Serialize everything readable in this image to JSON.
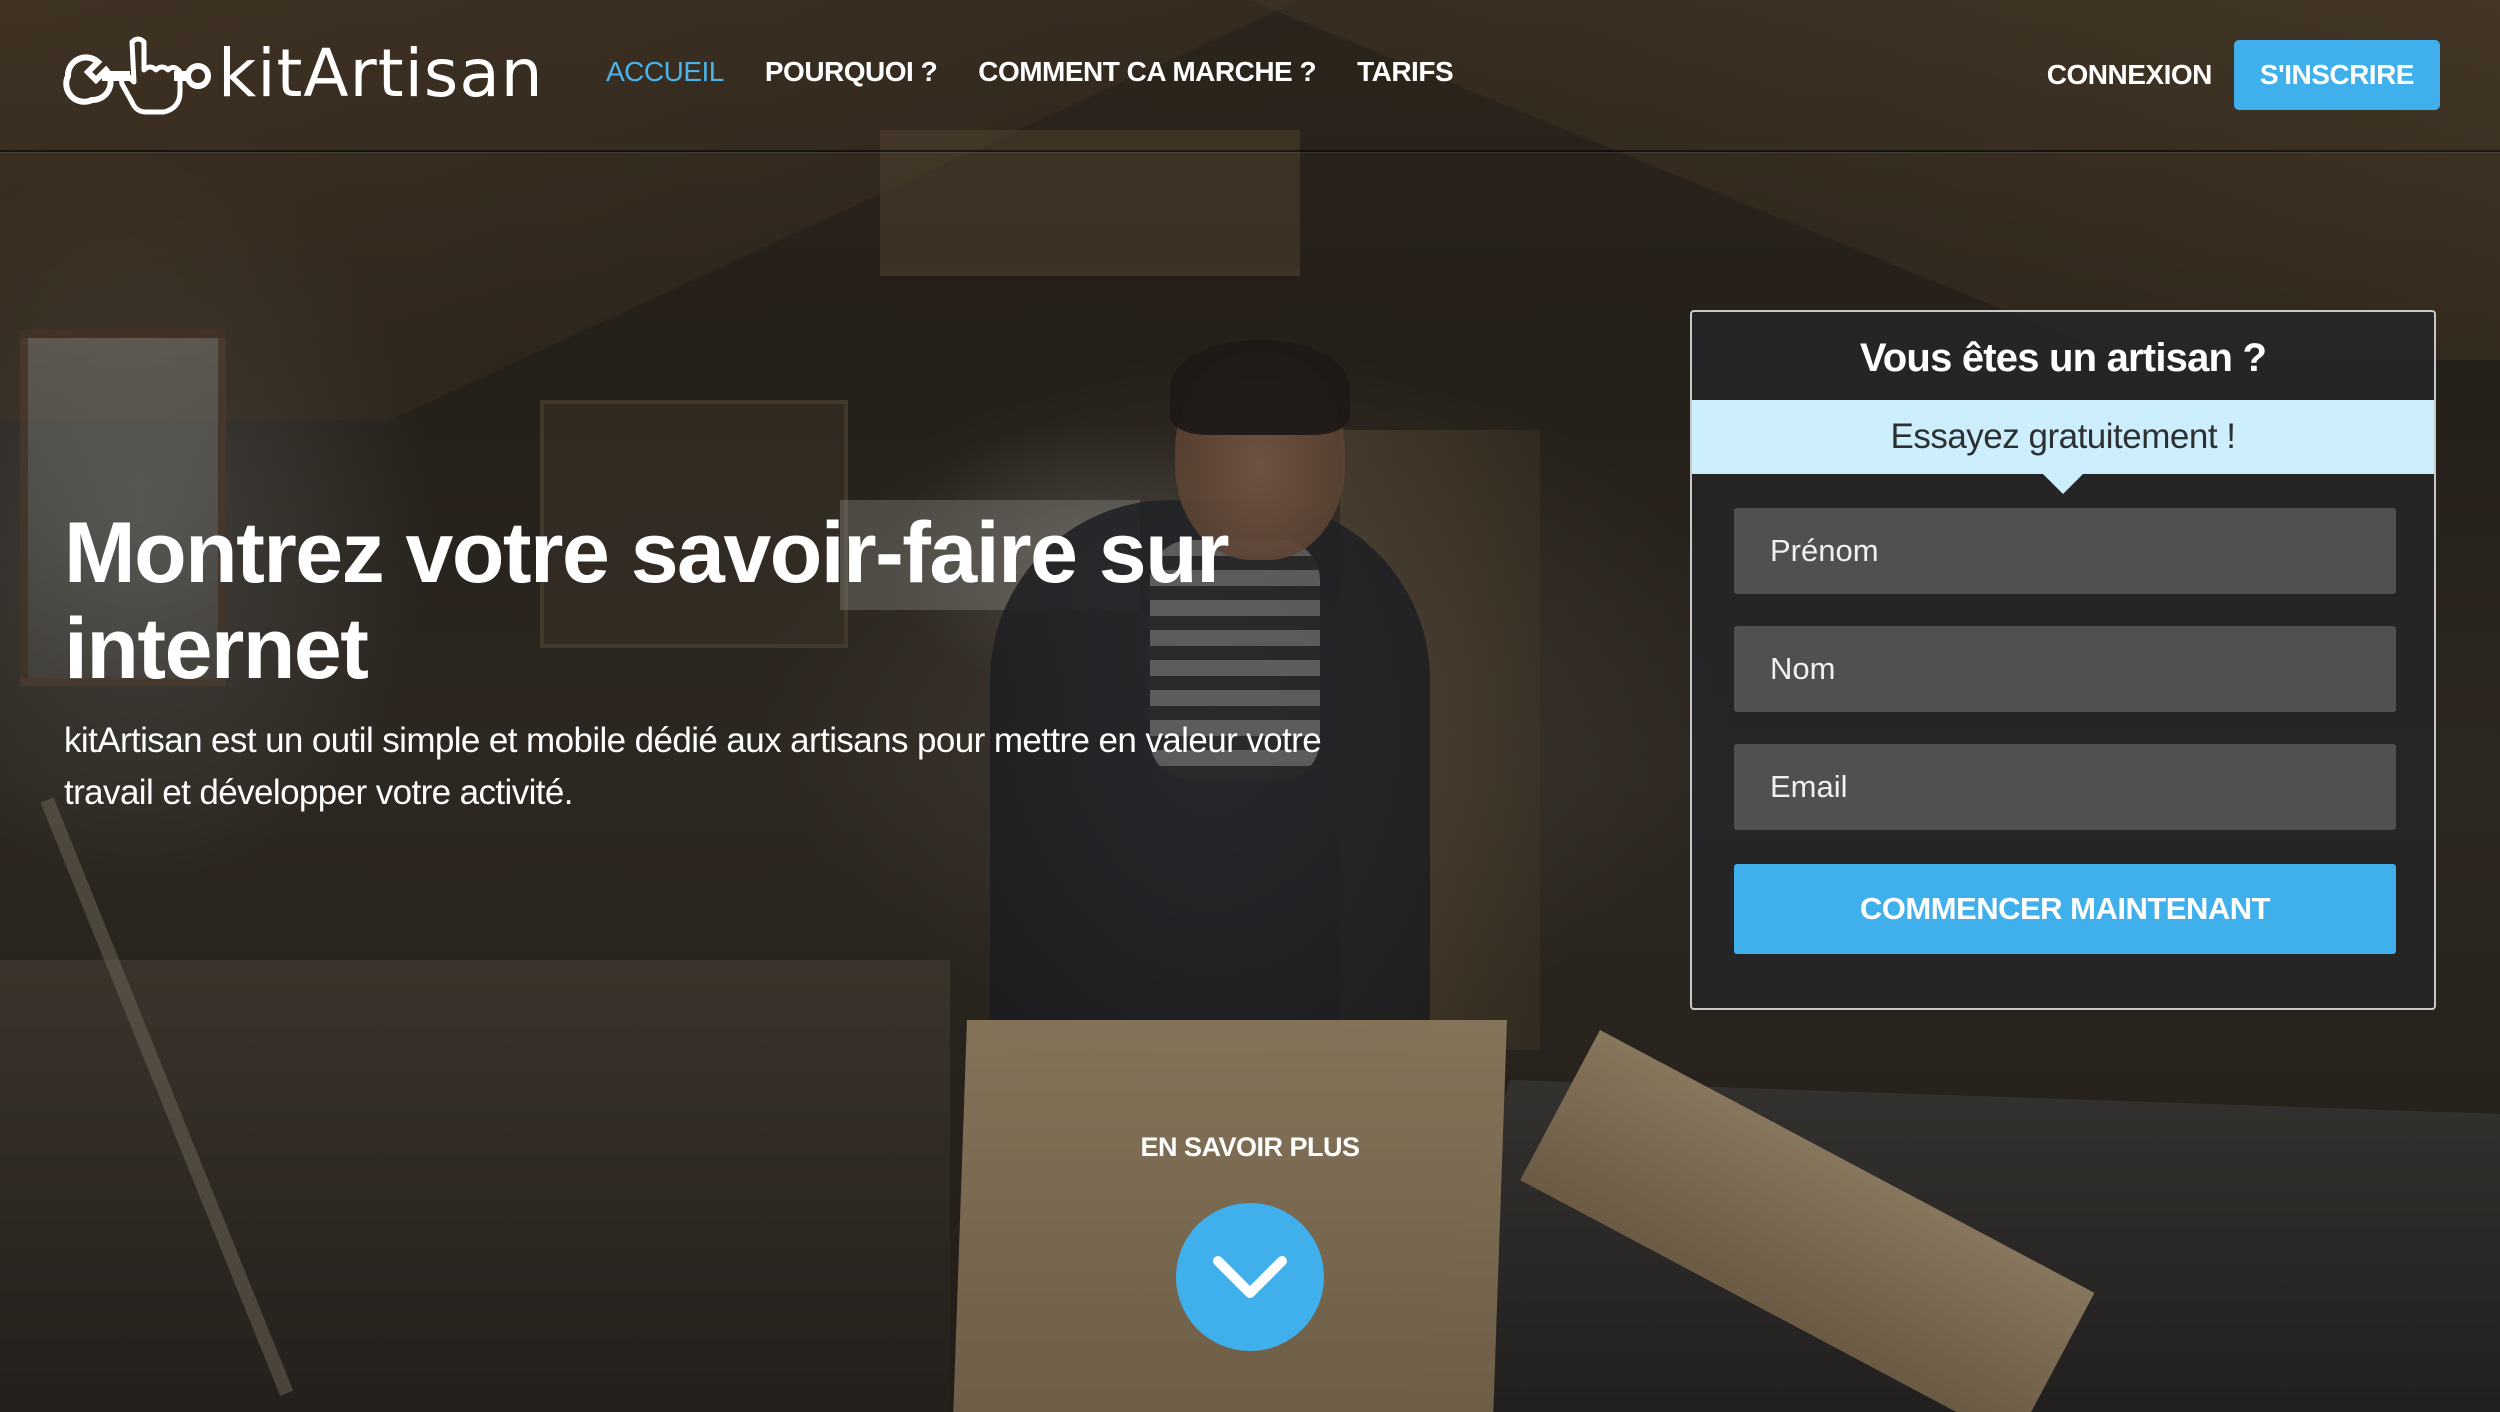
{
  "brand": {
    "name": "kitArtisan"
  },
  "nav": {
    "links": [
      {
        "label": "ACCUEIL",
        "active": true
      },
      {
        "label": "POURQUOI ?",
        "active": false
      },
      {
        "label": "COMMENT CA MARCHE ?",
        "active": false
      },
      {
        "label": "TARIFS",
        "active": false
      }
    ],
    "login_label": "CONNEXION",
    "signup_label": "S'INSCRIRE"
  },
  "hero": {
    "title": "Montrez votre savoir-faire sur internet",
    "subtitle": "kitArtisan est un outil simple et mobile dédié aux artisans pour mettre en valeur votre travail et développer votre activité."
  },
  "signup_card": {
    "title": "Vous êtes un artisan ?",
    "banner": "Essayez gratuitement !",
    "fields": {
      "first_name_placeholder": "Prénom",
      "last_name_placeholder": "Nom",
      "email_placeholder": "Email"
    },
    "submit_label": "COMMENCER MAINTENANT"
  },
  "learn_more": {
    "label": "EN SAVOIR PLUS",
    "icon": "chevron-down-icon"
  },
  "colors": {
    "accent": "#3fb0ec",
    "nav_active": "#4bb3e8",
    "banner_bg": "#cdeefc",
    "card_bg": "#262628",
    "field_bg": "#58585c"
  },
  "icons": {
    "logo": "wrench-hand-cursor-icon"
  }
}
